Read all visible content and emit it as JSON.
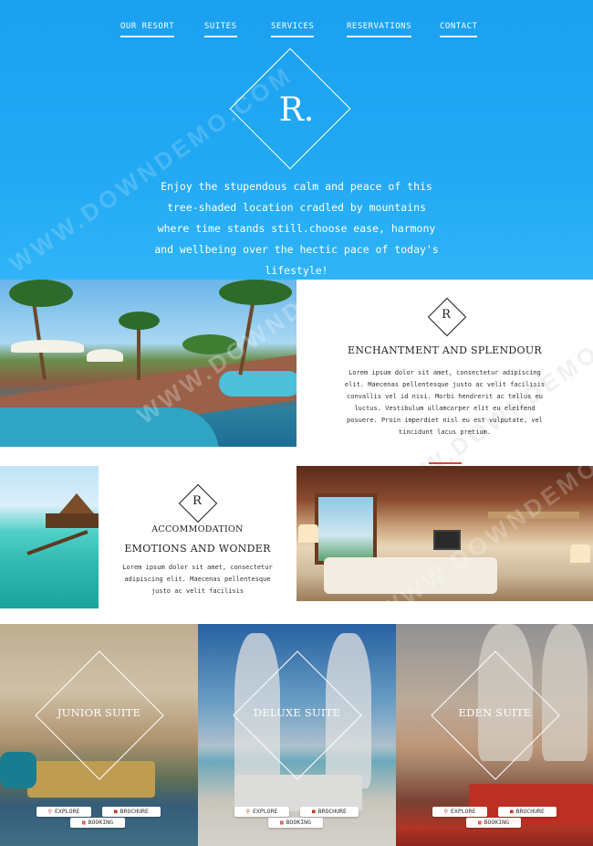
{
  "nav": {
    "items": [
      "OUR RESORT",
      "SUITES",
      "SERVICES",
      "RESERVATIONS",
      "CONTACT"
    ]
  },
  "hero": {
    "logo_letter": "R.",
    "text_lines": [
      "Enjoy the stupendous calm and peace of this",
      "tree-shaded location cradled by mountains",
      "where time stands still.choose ease, harmony",
      "and wellbeing over the hectic pace of today's",
      "lifestyle!"
    ]
  },
  "watermark": "WWW.DOWNDEMO.COM",
  "section_enchantment": {
    "logo_letter": "R",
    "title": "ENCHANTMENT AND SPLENDOUR",
    "body_lines": [
      "Lorem ipsum dolor sit amet, consectetur adipiscing",
      "elit. Maecenas pellentesque justo ac velit facilisis",
      "convallis vel id nisi. Morbi hendrerit ac tellus eu",
      "luctus. Vestibulum ullamcorper elit eu eleifend",
      "posuere. Proin imperdiet nisl eu est vulputate, vel",
      "tincidunt lacus pretium."
    ]
  },
  "section_accommodation": {
    "logo_letter": "R",
    "kicker": "ACCOMMODATION",
    "title": "EMOTIONS AND WONDER",
    "body_lines": [
      "Lorem ipsum dolor sit amet, consectetur",
      "adipiscing elit. Maecenas pellentesque",
      "justo ac velit facilisis"
    ]
  },
  "suites": [
    {
      "name": "JUNIOR SUITE",
      "explore": "EXPLORE",
      "brochure": "BROCHURE",
      "booking": "BOOKING"
    },
    {
      "name": "DELUXE SUITE",
      "explore": "EXPLORE",
      "brochure": "BROCHURE",
      "booking": "BOOKING"
    },
    {
      "name": "EDEN SUITE",
      "explore": "EXPLORE",
      "brochure": "BROCHURE",
      "booking": "BOOKING"
    }
  ],
  "colors": {
    "hero_blue": "#1fa5f1",
    "accent_red": "#d0463b",
    "text_dark": "#222222"
  }
}
